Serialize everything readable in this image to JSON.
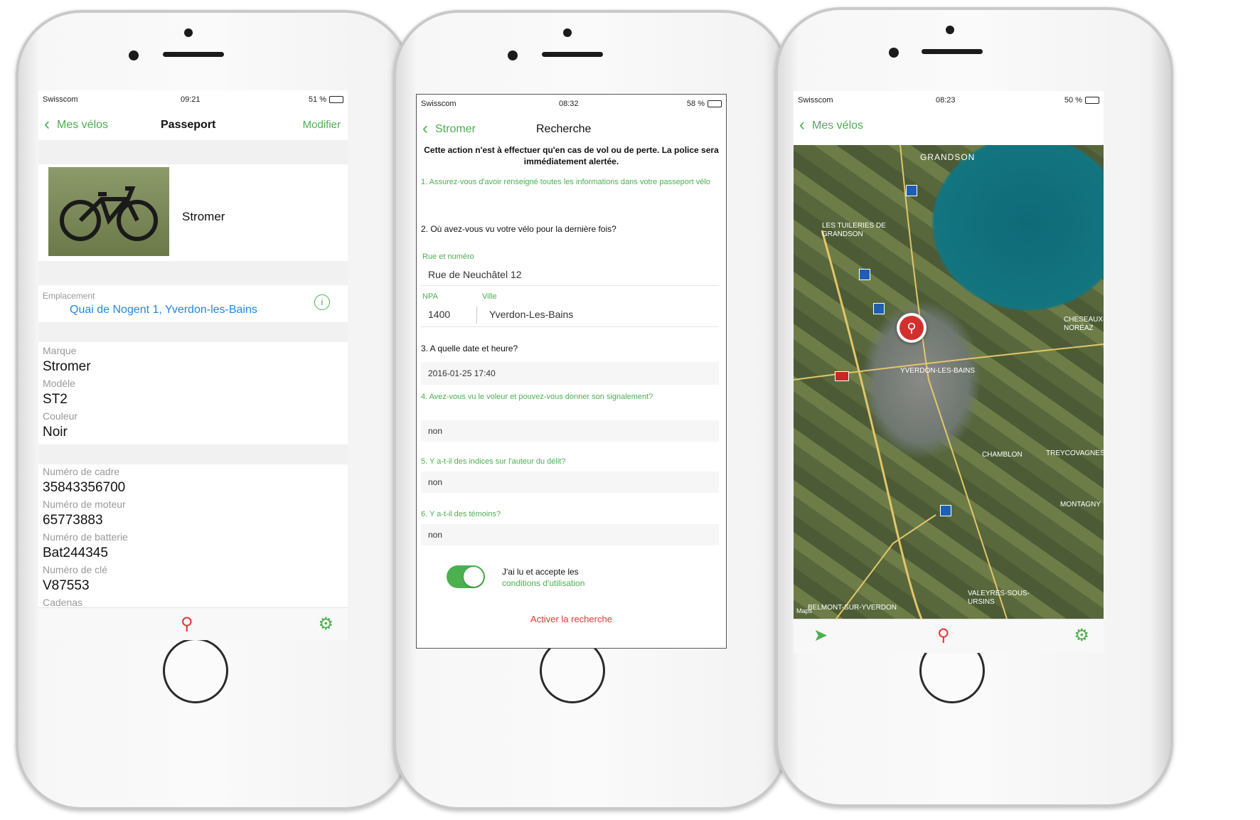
{
  "colors": {
    "accent": "#4caf50",
    "link": "#1e88e5",
    "alert": "#e53935",
    "bike_marker": "#d32f2f"
  },
  "phone1": {
    "status": {
      "carrier": "Swisscom",
      "time": "09:21",
      "battery": "51 %"
    },
    "nav": {
      "back": "Mes vélos",
      "title": "Passeport",
      "action": "Modifier"
    },
    "bike_name": "Stromer",
    "location": {
      "label": "Emplacement",
      "address": "Quai de Nogent 1, Yverdon-les-Bains"
    },
    "fields": [
      {
        "label": "Marque",
        "value": "Stromer"
      },
      {
        "label": "Modèle",
        "value": "ST2"
      },
      {
        "label": "Couleur",
        "value": "Noir"
      }
    ],
    "numbers": [
      {
        "label": "Numéro de cadre",
        "value": "35843356700"
      },
      {
        "label": "Numéro de moteur",
        "value": "65773883"
      },
      {
        "label": "Numéro de batterie",
        "value": "Bat244345"
      },
      {
        "label": "Numéro de clé",
        "value": "V87553"
      },
      {
        "label": "Cadenas",
        "value": ""
      }
    ],
    "icons": {
      "search_tab": "bike-search-icon",
      "settings_tab": "gear-icon",
      "info": "info-icon"
    }
  },
  "phone2": {
    "status": {
      "carrier": "Swisscom",
      "time": "08:32",
      "battery": "58 %"
    },
    "nav": {
      "back": "Stromer",
      "title": "Recherche"
    },
    "intro": "Cette action n'est à effectuer qu'en cas de vol ou de perte. La police sera immédiatement alertée.",
    "q1": "1. Assurez-vous d'avoir renseigné toutes les informations dans votre passeport vélo",
    "q2": "2. Où avez-vous vu votre vélo pour la dernière fois?",
    "street_label": "Rue et numéro",
    "street_value": "Rue de Neuchâtel 12",
    "npa_label": "NPA",
    "npa_value": "1400",
    "city_label": "Ville",
    "city_value": "Yverdon-Les-Bains",
    "q3": "3. A quelle date et heure?",
    "date_value": "2016-01-25 17:40",
    "q4": "4. Avez-vous vu le voleur et pouvez-vous donner son signalement?",
    "a4": "non",
    "q5": "5. Y a-t-il des indices sur l'auteur du délit?",
    "a5": "non",
    "q6": "6. Y a-t-il des témoins?",
    "a6": "non",
    "terms_line1": "J'ai lu et accepte les",
    "terms_line2": "conditions d'utilisation",
    "terms_accepted": true,
    "activate": "Activer la recherche"
  },
  "phone3": {
    "status": {
      "carrier": "Swisscom",
      "time": "08:23",
      "battery": "50 %"
    },
    "nav": {
      "back": "Mes vélos"
    },
    "map_labels": [
      "GRANDSON",
      "LES TUILERIES DE GRANDSON",
      "YVERDON-LES-BAINS",
      "CHESEAUX-NORÉAZ",
      "CHAMBLON",
      "VALEYRES-SOUS-URSINS",
      "BELMONT-SUR-YVERDON",
      "MONTAGNY",
      "TREYCOVAGNES"
    ],
    "map_credit": "Maps",
    "icons": {
      "locate_tab": "location-arrow-icon",
      "search_tab": "bike-search-icon",
      "settings_tab": "gear-icon",
      "marker": "bike-marker-icon"
    }
  }
}
